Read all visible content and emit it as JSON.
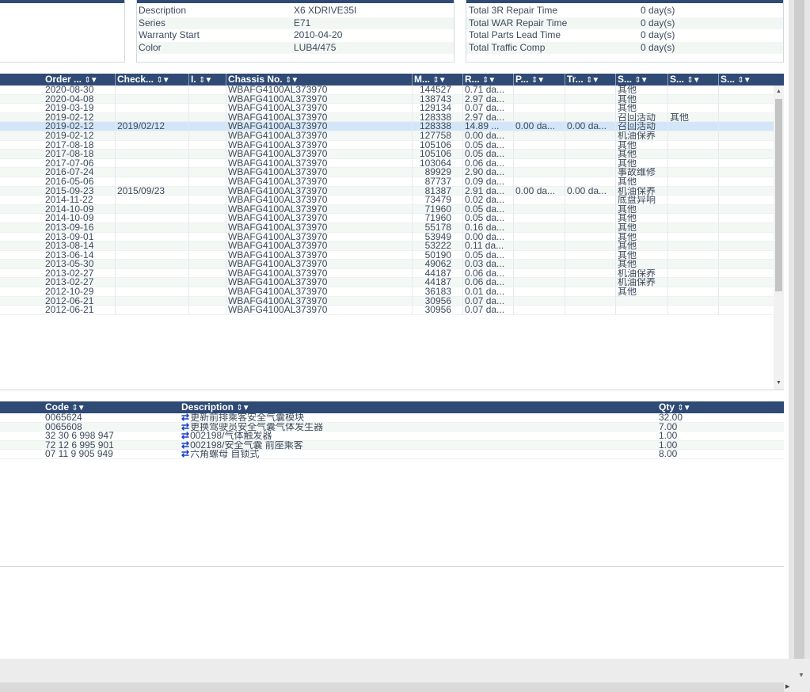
{
  "vehicle_info": {
    "rows": [
      {
        "label": "Description",
        "value": "X6 XDRIVE35I"
      },
      {
        "label": "Series",
        "value": "E71"
      },
      {
        "label": "Warranty Start",
        "value": "2010-04-20"
      },
      {
        "label": "Color",
        "value": "LUB4/475"
      }
    ]
  },
  "totals": {
    "rows": [
      {
        "label": "Total 3R Repair Time",
        "value": "0 day(s)"
      },
      {
        "label": "Total WAR Repair Time",
        "value": "0 day(s)"
      },
      {
        "label": "Total Parts Lead Time",
        "value": "0 day(s)"
      },
      {
        "label": "Total Traffic Comp",
        "value": "0 day(s)"
      }
    ]
  },
  "orders": {
    "headers": [
      "Order ...",
      "Check...",
      "I.",
      "Chassis No.",
      "M...",
      "R...",
      "P...",
      "Tr...",
      "S...",
      "S...",
      "S..."
    ],
    "sort_glyph": "⇕▼",
    "rows": [
      [
        "2020-08-30",
        "",
        "",
        "WBAFG4100AL373970",
        "144527",
        "0.71 da...",
        "",
        "",
        "其他",
        "",
        ""
      ],
      [
        "2020-04-08",
        "",
        "",
        "WBAFG4100AL373970",
        "138743",
        "2.97 da...",
        "",
        "",
        "其他",
        "",
        ""
      ],
      [
        "2019-03-19",
        "",
        "",
        "WBAFG4100AL373970",
        "129134",
        "0.07 da...",
        "",
        "",
        "其他",
        "",
        ""
      ],
      [
        "2019-02-12",
        "",
        "",
        "WBAFG4100AL373970",
        "128338",
        "2.97 da...",
        "",
        "",
        "召回活动",
        "其他",
        ""
      ],
      [
        "2019-02-12",
        "2019/02/12",
        "",
        "WBAFG4100AL373970",
        "128338",
        "14.89 ...",
        "0.00 da...",
        "0.00 da...",
        "召回活动",
        "",
        ""
      ],
      [
        "2019-02-12",
        "",
        "",
        "WBAFG4100AL373970",
        "127758",
        "0.00 da...",
        "",
        "",
        "机油保养",
        "",
        ""
      ],
      [
        "2017-08-18",
        "",
        "",
        "WBAFG4100AL373970",
        "105106",
        "0.05 da...",
        "",
        "",
        "其他",
        "",
        ""
      ],
      [
        "2017-08-18",
        "",
        "",
        "WBAFG4100AL373970",
        "105106",
        "0.05 da...",
        "",
        "",
        "其他",
        "",
        ""
      ],
      [
        "2017-07-06",
        "",
        "",
        "WBAFG4100AL373970",
        "103064",
        "0.06 da...",
        "",
        "",
        "其他",
        "",
        ""
      ],
      [
        "2016-07-24",
        "",
        "",
        "WBAFG4100AL373970",
        "89929",
        "2.90 da...",
        "",
        "",
        "事故维修",
        "",
        ""
      ],
      [
        "2016-05-06",
        "",
        "",
        "WBAFG4100AL373970",
        "87737",
        "0.09 da...",
        "",
        "",
        "其他",
        "",
        ""
      ],
      [
        "2015-09-23",
        "2015/09/23",
        "",
        "WBAFG4100AL373970",
        "81387",
        "2.91 da...",
        "0.00 da...",
        "0.00 da...",
        "机油保养",
        "",
        ""
      ],
      [
        "2014-11-22",
        "",
        "",
        "WBAFG4100AL373970",
        "73479",
        "0.02 da...",
        "",
        "",
        "底盘异响",
        "",
        ""
      ],
      [
        "2014-10-09",
        "",
        "",
        "WBAFG4100AL373970",
        "71960",
        "0.05 da...",
        "",
        "",
        "其他",
        "",
        ""
      ],
      [
        "2014-10-09",
        "",
        "",
        "WBAFG4100AL373970",
        "71960",
        "0.05 da...",
        "",
        "",
        "其他",
        "",
        ""
      ],
      [
        "2013-09-16",
        "",
        "",
        "WBAFG4100AL373970",
        "55178",
        "0.16 da...",
        "",
        "",
        "其他",
        "",
        ""
      ],
      [
        "2013-09-01",
        "",
        "",
        "WBAFG4100AL373970",
        "53949",
        "0.00 da...",
        "",
        "",
        "其他",
        "",
        ""
      ],
      [
        "2013-08-14",
        "",
        "",
        "WBAFG4100AL373970",
        "53222",
        "0.11 da...",
        "",
        "",
        "其他",
        "",
        ""
      ],
      [
        "2013-06-14",
        "",
        "",
        "WBAFG4100AL373970",
        "50190",
        "0.05 da...",
        "",
        "",
        "其他",
        "",
        ""
      ],
      [
        "2013-05-30",
        "",
        "",
        "WBAFG4100AL373970",
        "49062",
        "0.03 da...",
        "",
        "",
        "其他",
        "",
        ""
      ],
      [
        "2013-02-27",
        "",
        "",
        "WBAFG4100AL373970",
        "44187",
        "0.06 da...",
        "",
        "",
        "机油保养",
        "",
        ""
      ],
      [
        "2013-02-27",
        "",
        "",
        "WBAFG4100AL373970",
        "44187",
        "0.06 da...",
        "",
        "",
        "机油保养",
        "",
        ""
      ],
      [
        "2012-10-29",
        "",
        "",
        "WBAFG4100AL373970",
        "36183",
        "0.01 da...",
        "",
        "",
        "其他",
        "",
        ""
      ],
      [
        "2012-06-21",
        "",
        "",
        "WBAFG4100AL373970",
        "30956",
        "0.07 da...",
        "",
        "",
        "",
        "",
        ""
      ],
      [
        "2012-06-21",
        "",
        "",
        "WBAFG4100AL373970",
        "30956",
        "0.07 da...",
        "",
        "",
        "",
        "",
        ""
      ]
    ],
    "selected_index": 4
  },
  "parts": {
    "headers": [
      "Code",
      "Description",
      "Qty"
    ],
    "swap_glyph": "⇄",
    "rows": [
      [
        "0065624",
        "更新前排乘客安全气囊模块",
        "32.00"
      ],
      [
        "0065608",
        "更换驾驶员安全气囊气体发生器",
        "7.00"
      ],
      [
        "32 30 6 998 947",
        "002198/气体触发器",
        "1.00"
      ],
      [
        "72 12 6 995 901",
        "002198/安全气囊 前座乘客",
        "1.00"
      ],
      [
        "07 11 9 905 949",
        "六角螺母 自锁式",
        "8.00"
      ]
    ]
  },
  "icons": {
    "sort": "sort-filter-icon",
    "swap": "swap-arrows-icon",
    "scroll_up": "scroll-up-arrow-icon",
    "scroll_down": "scroll-down-arrow-icon",
    "scroll_right": "scroll-right-arrow-icon"
  },
  "colors": {
    "header_bg": "#2f4a74",
    "selected_row": "#d2e6f7",
    "alt_row": "#f4f8f5",
    "swap_icon": "#1a3fc8"
  }
}
